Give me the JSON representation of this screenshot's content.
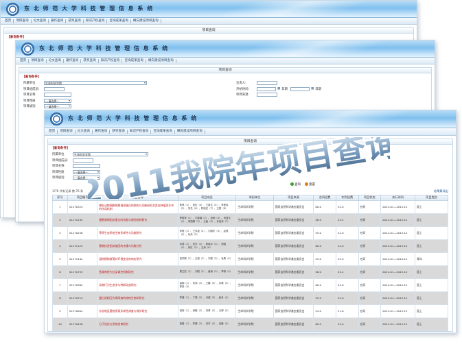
{
  "app_title": "东 北 师 范 大 学 科 技 管 理 信 息 系 统",
  "nav_items": [
    "首页",
    "项目查询",
    "论文查询",
    "著作查询",
    "获奖查询",
    "知识产权查询",
    "咨询成果查询",
    "横向建设项目查询"
  ],
  "panel_title": "项目查询",
  "conditions_label": "【查询条件】",
  "form": {
    "dept_label": "所属单位",
    "dept_value": "生命科学学院",
    "member_label": "项目组成员:",
    "name_label": "项目名称",
    "type_label": "项目性质",
    "type_value": "---请选择---",
    "level_label": "项目级别",
    "level_value": "---请选择---",
    "leader_label": "负责人:",
    "start_label": "开始时间:",
    "date_btn": "日期",
    "source_label": "项目来源"
  },
  "buttons": {
    "search": "查询",
    "reset": "重置"
  },
  "result": {
    "summary": "1/76  共有记录 数 76 条",
    "export": "结果集导出"
  },
  "table": {
    "headers": [
      "序号",
      "项目编号",
      "项目名称",
      "项目成员",
      "承担单位",
      "项目来源",
      "合同经费",
      "实到经费",
      "项目状态",
      "执行时间",
      "项目类别"
    ],
    "rows": [
      {
        "no": "1",
        "code": "S1270324",
        "name": "哺乳动物细胞周期调控蛋白的结构与功能研究及其在肿瘤发生中的作用机制",
        "members": "詹林（1）、张红（3）、王新文（4）、李爱军（5）、刘杰（6）、陈晓红（7）、王丽（8）",
        "unit": "生命科学学院",
        "source": "国家自然科学基金委员会",
        "fund": "80.0",
        "arrived": "32.0",
        "status": "在研",
        "time": "2012-01—2015-12",
        "kind": "面上"
      },
      {
        "no": "2",
        "code": "S1271245",
        "name": "细胞周期相关蛋白的功能与调控机制研究",
        "members": "罗丽萍（1）、刘惠娟（2）、彭明（3）、肖显东（4）、宋丽娜（5）、王鑫（6）、孙宏伟（7）",
        "unit": "生命科学学院",
        "source": "国家自然科学基金委员会",
        "fund": "58.0",
        "arrived": "23.2",
        "status": "在研",
        "time": "2012-01—2015-12",
        "kind": "面上"
      },
      {
        "no": "3",
        "code": "S1270256",
        "name": "草原生态系统生物多样性与功能研究",
        "members": "李丽（1）、王洪波（2）、刘振东（3）、赵美（4）、孙伟（5）",
        "unit": "生命科学学院",
        "source": "国家自然科学基金委员会",
        "fund": "55.0",
        "arrived": "22.0",
        "status": "在研",
        "time": "2012-01—2015-12",
        "kind": "面上"
      },
      {
        "no": "4",
        "code": "S1271125",
        "name": "植物抗逆相关基因的克隆与功能分析",
        "members": "孙丽（1）、刘东（2）、陈晓宇（3）、郑国（4）、朱红（5）、王涛（6）",
        "unit": "生命科学学院",
        "source": "国家自然科学基金委员会",
        "fund": "60.0",
        "arrived": "24.0",
        "status": "在研",
        "time": "2012-01—2015-12",
        "kind": "面上"
      },
      {
        "no": "5",
        "code": "S1271442",
        "name": "湿地植物群落对环境变化的响应研究",
        "members": "张洪刚（1）、王毅（2）、刘俊（3）、杜鹃（4）",
        "unit": "生命科学学院",
        "source": "国家自然科学基金委员会",
        "fund": "25.0",
        "arrived": "25.0",
        "status": "在研",
        "time": "2012-01—2014-12",
        "kind": "青年"
      },
      {
        "no": "6",
        "code": "S1270755",
        "name": "鱼类神经内分泌调控机制研究",
        "members": "周立宏（1）、刘丽（2）、姜涛（3）、李明（4）",
        "unit": "生命科学学院",
        "source": "国家自然科学基金委员会",
        "fund": "56.0",
        "arrived": "22.4",
        "status": "在研",
        "time": "2012-01—2015-12",
        "kind": "面上"
      },
      {
        "no": "7",
        "code": "S1270964",
        "name": "动物行为生态学与种群动态研究",
        "members": "高翔（1）、刘伟（2）、王鹏（3）、孙静（4）、郭亮（5）",
        "unit": "生命科学学院",
        "source": "国家自然科学基金委员会",
        "fund": "60.0",
        "arrived": "24.0",
        "status": "在研",
        "time": "2012-01—2015-12",
        "kind": "面上"
      },
      {
        "no": "8",
        "code": "S1270719",
        "name": "蛋白质相互作用网络的结构生物学研究",
        "members": "李健（1）、丁丽（2）、马超（3）、赵丹（4）",
        "unit": "生命科学学院",
        "source": "国家自然科学基金委员会",
        "fund": "55.0",
        "arrived": "22.0",
        "status": "在研",
        "time": "2012-01—2015-12",
        "kind": "面上"
      },
      {
        "no": "9",
        "code": "S1270804",
        "name": "东北地区植物资源多样性调查与保护研究",
        "members": "宫辉（1）、张敏（2）、刘青（3）、王博（4）",
        "unit": "生命科学学院",
        "source": "国家自然科学基金委员会",
        "fund": "54.0",
        "arrived": "21.6",
        "status": "在研",
        "time": "2012-01—2015-12",
        "kind": "面上"
      },
      {
        "no": "10",
        "code": "S1270436",
        "name": "分子进化与系统发育研究",
        "members": "杨春（1）、李娜（2）、刘洋（3）、高峰（4）",
        "unit": "生命科学学院",
        "source": "国家自然科学基金委员会",
        "fund": "60.0",
        "arrived": "24.0",
        "status": "在研",
        "time": "2012-01—2015-12",
        "kind": "面上"
      }
    ]
  },
  "overlay_caption": "2011我院年项目查询"
}
